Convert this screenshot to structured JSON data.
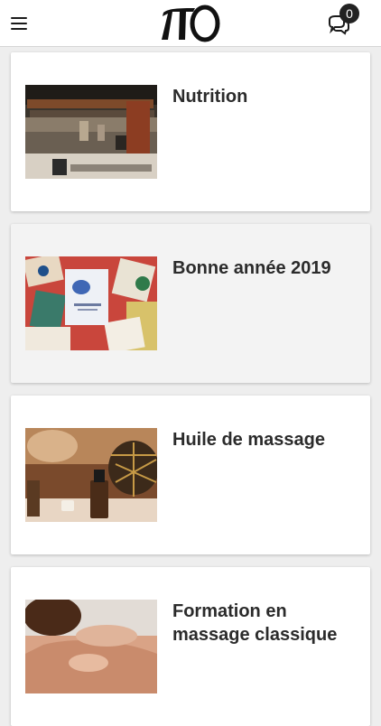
{
  "header": {
    "logo_text": "πO",
    "notification_count": "0"
  },
  "articles": [
    {
      "title": "Nutrition"
    },
    {
      "title": "Bonne année 2019"
    },
    {
      "title": "Huile de massage"
    },
    {
      "title": "Formation en massage classique"
    }
  ]
}
